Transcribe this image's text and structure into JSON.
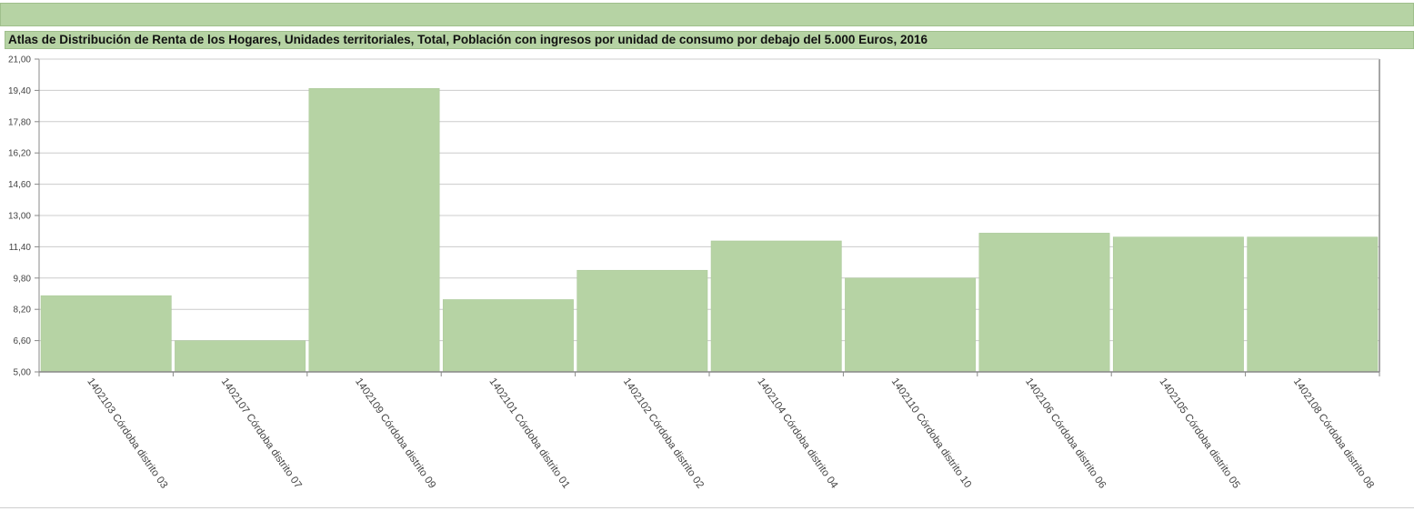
{
  "colors": {
    "bar": "#b6d3a4",
    "band": "#b6d3a4",
    "grid": "#cccccc",
    "axis": "#888888"
  },
  "chart_data": {
    "type": "bar",
    "title": "Atlas de Distribución de Renta de los Hogares, Unidades territoriales, Total, Población con ingresos por unidad de consumo por debajo del 5.000 Euros, 2016",
    "xlabel": "",
    "ylabel": "",
    "ylim": [
      5.0,
      21.0
    ],
    "yticks": [
      "5,00",
      "6,60",
      "8,20",
      "9,80",
      "11,40",
      "13,00",
      "14,60",
      "16,20",
      "17,80",
      "19,40",
      "21,00"
    ],
    "grid": true,
    "categories": [
      "1402103 Córdoba distrito 03",
      "1402107 Córdoba distrito 07",
      "1402109 Córdoba distrito 09",
      "1402101 Córdoba distrito 01",
      "1402102 Córdoba distrito 02",
      "1402104 Córdoba distrito 04",
      "1402110 Córdoba distrito 10",
      "1402106 Córdoba distrito 06",
      "1402105 Córdoba distrito 05",
      "1402108 Córdoba distrito 08"
    ],
    "values": [
      8.9,
      6.6,
      19.5,
      8.7,
      10.2,
      11.7,
      9.8,
      12.1,
      11.9,
      11.9
    ]
  }
}
